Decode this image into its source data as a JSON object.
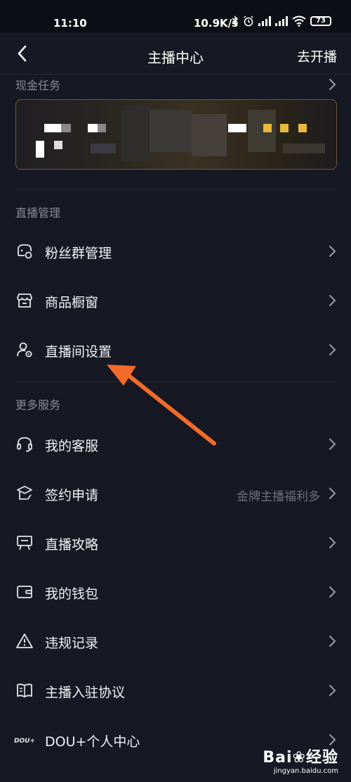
{
  "status_bar": {
    "time": "11:10",
    "network_speed": "10.9K/s",
    "battery": "73"
  },
  "navbar": {
    "title": "主播中心",
    "right_action": "去开播"
  },
  "cash_task": {
    "title": "现金任务"
  },
  "sections": {
    "live_management": {
      "title": "直播管理",
      "items": [
        {
          "label": "粉丝群管理",
          "icon": "fan-group-icon"
        },
        {
          "label": "商品橱窗",
          "icon": "storefront-icon"
        },
        {
          "label": "直播间设置",
          "icon": "user-settings-icon"
        }
      ]
    },
    "more_services": {
      "title": "更多服务",
      "items": [
        {
          "label": "我的客服",
          "icon": "headset-icon"
        },
        {
          "label": "签约申请",
          "icon": "contract-icon",
          "hint": "金牌主播福利多"
        },
        {
          "label": "直播攻略",
          "icon": "easel-icon"
        },
        {
          "label": "我的钱包",
          "icon": "wallet-icon"
        },
        {
          "label": "违规记录",
          "icon": "warning-icon"
        },
        {
          "label": "主播入驻协议",
          "icon": "book-icon"
        },
        {
          "label": "DOU+个人中心",
          "icon": "dou-plus-icon"
        }
      ]
    }
  },
  "watermark": {
    "logo": "Bai❀经验",
    "url": "jingyan.baidu.com"
  },
  "colors": {
    "background": "#161823",
    "annotation_arrow": "#f26b2a",
    "banner_accent": "#e8b83a"
  }
}
